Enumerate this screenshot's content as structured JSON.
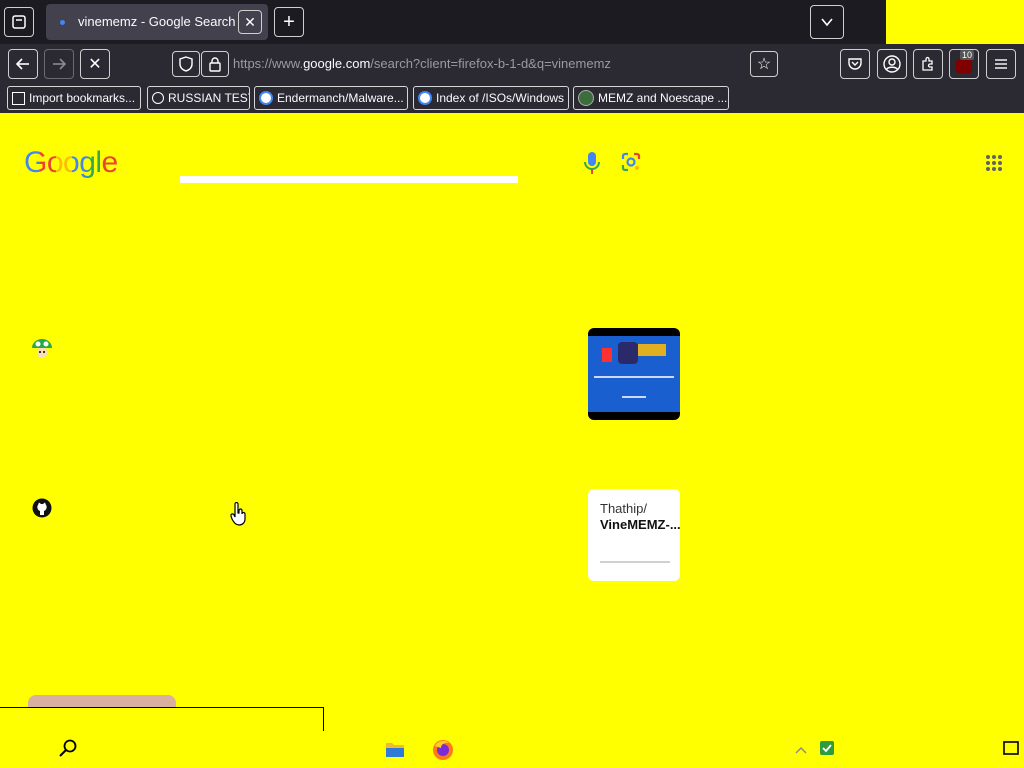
{
  "browser": {
    "tab": {
      "title": "vinememz - Google Search"
    },
    "url": {
      "prefix": "https://www.",
      "domain": "google.com",
      "path": "/search?client=firefox-b-1-d&q=vinememz"
    },
    "bookmarks": [
      {
        "label": "Import bookmarks...",
        "icon": "import-icon"
      },
      {
        "label": "RUSSIAN TEST",
        "icon": "search-icon"
      },
      {
        "label": "Endermanch/Malware...",
        "icon": "google-icon"
      },
      {
        "label": "Index of /ISOs/Windows",
        "icon": "google-icon"
      },
      {
        "label": "MEMZ and Noescape ...",
        "icon": "site-icon"
      }
    ],
    "notification_badge": "10"
  },
  "google": {
    "logo_text": "Google",
    "results": [
      {
        "thumbnail_text": "Thathip/",
        "thumbnail_subtext": "VineMEMZ-..."
      }
    ]
  },
  "colors": {
    "page_background": "#ffff00",
    "chrome_dark": "#1c1b22",
    "toolbar": "#2b2a33",
    "accent_blue": "#4285f4"
  }
}
